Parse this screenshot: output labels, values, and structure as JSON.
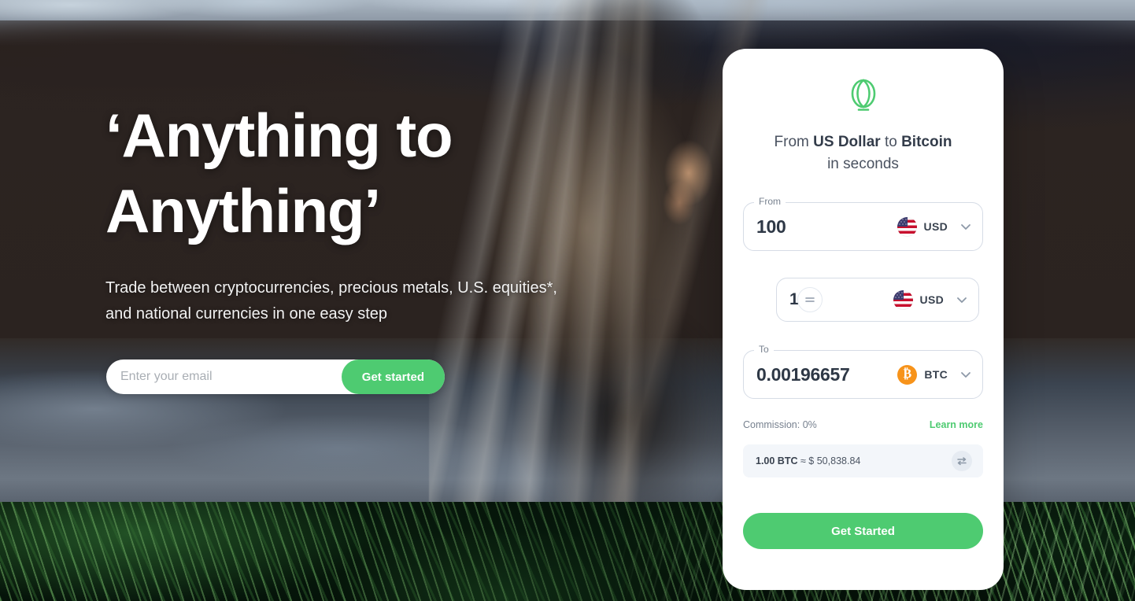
{
  "hero": {
    "headline": "‘Anything to\nAnything’",
    "subhead": "Trade between cryptocurrencies, precious metals, U.S. equities*, and national currencies in one easy step",
    "email_placeholder": "Enter your email",
    "email_value": "",
    "signup_button": "Get started"
  },
  "card": {
    "logo": "balloon-logo",
    "title_prefix": "From ",
    "title_from": "US Dollar",
    "title_mid": " to ",
    "title_to": "Bitcoin",
    "title_suffix": "in seconds",
    "from_field": {
      "legend": "From",
      "value": "100",
      "currency_code": "USD",
      "currency_icon": "us-flag-icon"
    },
    "mid_field": {
      "legend": "",
      "value": "100",
      "currency_code": "USD",
      "currency_icon": "us-flag-icon",
      "swap_symbol": "≈"
    },
    "to_field": {
      "legend": "To",
      "value": "0.00196657",
      "currency_code": "BTC",
      "currency_icon": "bitcoin-icon",
      "bitcoin_glyph": "₿"
    },
    "commission_label": "Commission: 0%",
    "learn_more": "Learn more",
    "rate_amount": "1.00 BTC",
    "rate_separator": " ≈ $ ",
    "rate_value": "50,838.84",
    "rate_full": "1.00 BTC ≈ $ 50,838.84",
    "cta_label": "Get Started"
  },
  "colors": {
    "accent_green": "#4ecb71",
    "bitcoin_orange": "#f7931a",
    "text_dark": "#2e3846",
    "text_muted": "#77818f",
    "border": "#d6dce6"
  }
}
